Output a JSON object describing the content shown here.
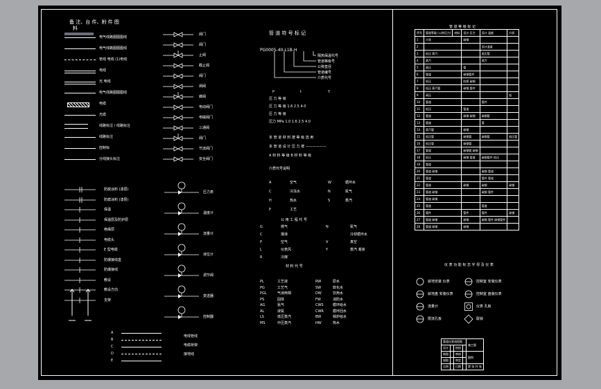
{
  "left_panel": {
    "title": "备 注、台 件、附 件 图",
    "title_2": "料",
    "line_labels": [
      "电气线路图图图线",
      "电气线路图图图线",
      "管线 电线 (1)电线",
      "电线",
      "光 电线",
      "电气线路图图图线",
      "电缆",
      "光缆",
      "线路标注 / 线路标注",
      "线路标注",
      "控制标",
      "分线接头标注"
    ],
    "symbol_labels_mid": [
      "阀门",
      "阀门",
      "止阀",
      "截止阀",
      "阀门",
      "闸阀",
      "蝶阀",
      "电动阀门",
      "电磁阀门",
      "三通阀",
      "阀门",
      "节流阀门",
      "安全阀门"
    ],
    "lower_labels": [
      "防腐涂料 (漆层)",
      "防腐涂料 (漆层)",
      "保温",
      "保温层及防护层",
      "绝缘层",
      "电缆头",
      "E 型电缆",
      "防爆接线盒",
      "防爆接线",
      "敷设",
      "敷设方向",
      "支架"
    ],
    "instrument_labels": [
      "压力表",
      "温度计",
      "流量计",
      "液位计",
      "调节阀",
      "变送器",
      "控制器"
    ],
    "bottom_labels": [
      "电线管线",
      "电缆桥架",
      "接地线"
    ],
    "mark_letters": [
      "A",
      "B",
      "C",
      "D",
      "E"
    ]
  },
  "center_panel": {
    "title": "管 道 符 号 标 记",
    "code": "PG0005-40-L1B-H",
    "code_labels": [
      "隔热保温代号",
      "管道等级号",
      "公称直径",
      "管道编号",
      "介质代号"
    ],
    "pressure_header": [
      "P",
      "t",
      "Y"
    ],
    "rows_a": [
      "压 力 等 级",
      "压 力 等 级   1.6  2.5  4.0",
      "压 力 等 级",
      "压力 MPa    1.0   1.6   2.5   4.0"
    ],
    "notes": [
      "本 管 道 材 料 按 等 级 选 用",
      "本 管 道 设 计 压 力 按 ——————",
      "A  材 料 等 级   B 材 料 等 级"
    ],
    "section_title": "介质代号说明",
    "medium_table": [
      [
        "A",
        "空气",
        "W",
        "循环水"
      ],
      [
        "C",
        "冷冻水",
        "N",
        "氮气"
      ],
      [
        "H",
        "热水",
        "S",
        "蒸汽"
      ],
      [
        "P",
        "工艺"
      ]
    ],
    "section_title_2": "公 用 工 程 代 号",
    "utility_table": [
      [
        "G",
        "燃气",
        "N",
        "氮气"
      ],
      [
        "C",
        "凝液",
        "",
        "冷却循环水"
      ],
      [
        "P",
        "空气",
        "V",
        "真空"
      ],
      [
        "L",
        "仪表风",
        "Y",
        "蒸汽 凝液"
      ],
      [
        "R",
        "冷媒",
        "",
        ""
      ]
    ],
    "section_title_3": "材 料 代 号",
    "material_table": [
      [
        "PL",
        "工艺液",
        "RW",
        "原水"
      ],
      [
        "PG",
        "工艺气",
        "SW",
        "软化水"
      ],
      [
        "PGL",
        "气液两相",
        "DW",
        "饮用水"
      ],
      [
        "PS",
        "固体",
        "FW",
        "消防水"
      ],
      [
        "AG",
        "氨气",
        "CWS",
        "循环给水"
      ],
      [
        "AL",
        "液氨",
        "CWR",
        "循环回水"
      ],
      [
        "LS",
        "低压蒸汽",
        "BW",
        "锅炉给水"
      ],
      [
        "MS",
        "中压蒸汽",
        "HW",
        "热水"
      ]
    ]
  },
  "right_panel": {
    "table_title": "管 道 等 级 标 记",
    "table_header": [
      "序号",
      "管道等级 (公称压力)",
      "材料",
      "设计 压力",
      "设计 温度",
      "介质"
    ],
    "table_rows": [
      [
        "1",
        "介质",
        "碳钢",
        "",
        ""
      ],
      [
        "2",
        "",
        "",
        "设计温度",
        ""
      ],
      [
        "3",
        "低压 蒸汽",
        "",
        "低压管",
        ""
      ],
      [
        "4",
        "蒸汽",
        "",
        "蒸汽",
        ""
      ],
      [
        "5",
        "高压",
        "管",
        "",
        ""
      ],
      [
        "6",
        "管道",
        "碳钢管件",
        "",
        ""
      ],
      [
        "7",
        "低压",
        "防腐 碳钢",
        "",
        ""
      ],
      [
        "8",
        "低压 蒸汽管",
        "碳钢 管件",
        "",
        ""
      ],
      [
        "9",
        "高压",
        "",
        "",
        "低"
      ],
      [
        "10",
        "管道",
        "",
        "管件",
        ""
      ],
      [
        "11",
        "低压",
        "管道",
        "",
        ""
      ],
      [
        "12",
        "管道",
        "碳钢 碳钢",
        "碳钢管",
        ""
      ],
      [
        "13",
        "管道",
        "",
        "管",
        ""
      ],
      [
        "14",
        "蒸汽管",
        "碳钢",
        "",
        ""
      ],
      [
        "15",
        "低压管",
        "碳钢管",
        "碳钢管",
        "低压管"
      ],
      [
        "16",
        "低压管",
        "碳钢管",
        "",
        ""
      ],
      [
        "17",
        "管道",
        "碳钢管 碳钢",
        "",
        ""
      ],
      [
        "18",
        "低压",
        "碳钢  管道",
        "碳钢管件 低压",
        ""
      ],
      [
        "19",
        "管道",
        "",
        "",
        ""
      ],
      [
        "20",
        "管道 碳钢",
        "",
        "碳钢 管道",
        ""
      ],
      [
        "21",
        "管道",
        "",
        "管件 管道",
        ""
      ],
      [
        "22",
        "管道",
        "碳钢",
        "碳钢",
        "碳钢"
      ],
      [
        "23",
        "管道 碳钢",
        "",
        "碳钢 管件",
        ""
      ],
      [
        "24",
        "管道 碳钢",
        "",
        "",
        ""
      ],
      [
        "25",
        "管道",
        "",
        "管道",
        ""
      ],
      [
        "26",
        "管件",
        "管件",
        "管件",
        "碳钢"
      ],
      [
        "27",
        "管道 碳钢",
        "碳钢",
        "碳钢 管件 碳钢管件",
        ""
      ],
      [
        "28",
        "管道 碳钢",
        "碳钢",
        "",
        ""
      ]
    ],
    "instrument_title": "仪 表 功 能 标 志 字 母 及 仪 表",
    "instrument_items": [
      "就地安装 仪表",
      "控制室 安装仪表",
      "就地盘 安装仪表",
      "控制室 盘装仪表",
      "流量计",
      "仪表 孔板",
      "限流孔板",
      "联锁"
    ],
    "titleblock": {
      "company": "管道仪表流程图",
      "project": "施工图",
      "rows": [
        [
          "设计",
          "",
          "校核",
          ""
        ],
        [
          "制图",
          "",
          "审核",
          ""
        ],
        [
          "描图",
          "",
          "审定",
          ""
        ],
        [
          "比例",
          "",
          "日期",
          ""
        ]
      ],
      "drawing_title": "图例",
      "sheet": "第 张 共 张"
    }
  }
}
